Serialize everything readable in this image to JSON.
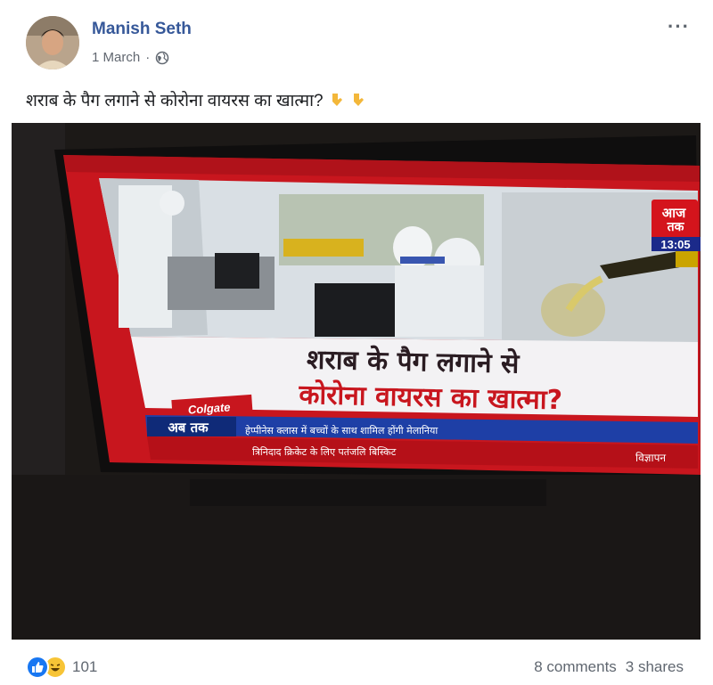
{
  "post": {
    "author": "Manish Seth",
    "date": "1 March",
    "separator": "·",
    "privacy_icon": "globe-icon",
    "more_icon": "···",
    "caption": "शराब के पैग लगाने से कोरोना वायरस का खात्मा?",
    "caption_emoji": [
      "pointing-down-icon",
      "pointing-down-icon"
    ]
  },
  "tv": {
    "channel_logo_line1": "आज",
    "channel_logo_line2": "तक",
    "time": "13:05",
    "headline_line1": "शराब के पैग लगाने से",
    "headline_line2": "कोरोना वायरस का खात्मा?",
    "sponsor": "Colgate",
    "ticker_label": "अब तक",
    "ticker_text": "हेप्पीनेस क्लास में बच्चों के साथ शामिल होंगी मेलानिया",
    "ad_text": "विज्ञापन",
    "ad_ticker": "त्रिनिदाद क्रिकेट के लिए पतंजलि बिस्किट"
  },
  "footer": {
    "reaction_count": "101",
    "comments": "8 comments",
    "shares": "3 shares"
  },
  "colors": {
    "author": "#365899",
    "tv_red": "#d11820",
    "ticker_blue": "#1e3fa6"
  }
}
